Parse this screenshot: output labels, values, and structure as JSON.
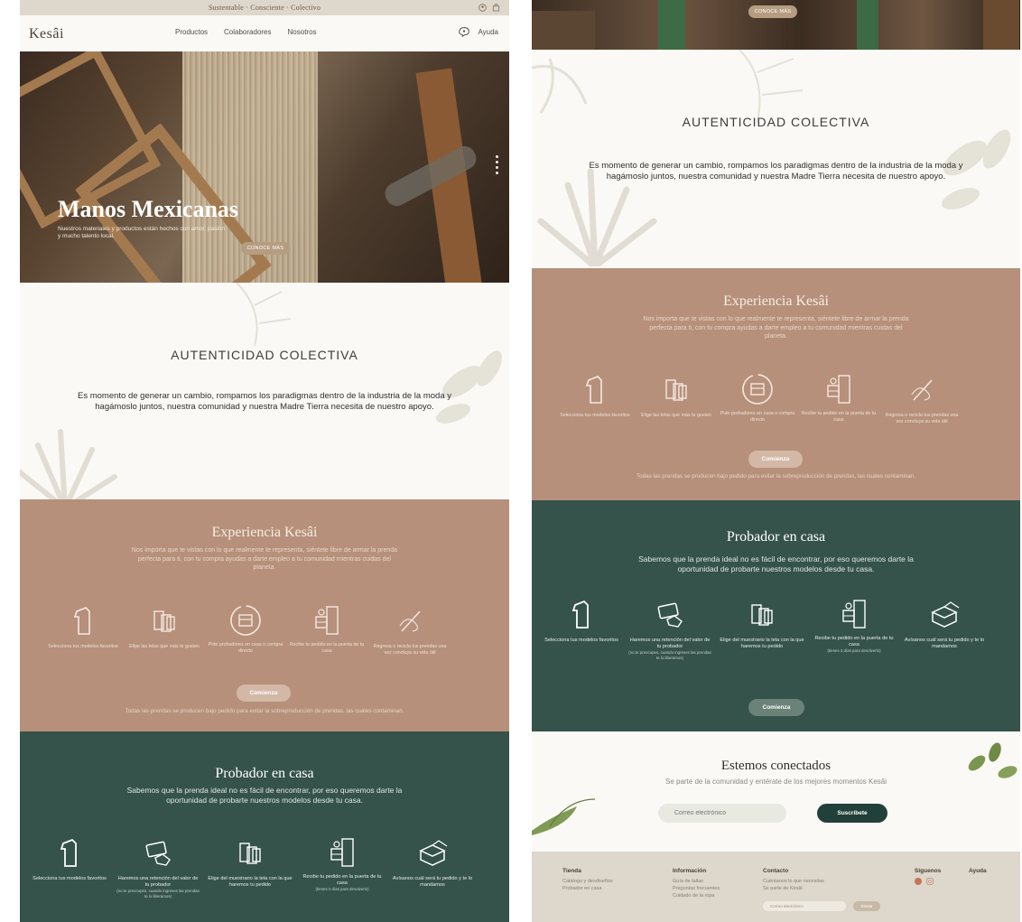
{
  "topbar": {
    "tagline": "Sustentable · Consciente · Colectivo"
  },
  "header": {
    "logo": "Kesâi",
    "nav": [
      "Productos",
      "Colaboradores",
      "Nosotros"
    ],
    "help_label": "Ayuda"
  },
  "hero": {
    "title": "Manos Mexicanas",
    "subtitle": "Nuestros materiales y productos están hechos con amor, pasión y mucho talento local.",
    "cta_label": "CONOCE MÁS"
  },
  "authenticity": {
    "title": "AUTENTICIDAD  COLECTIVA",
    "text": "Es momento de generar un cambio, rompamos los paradigmas dentro de la industria de la moda y hagámoslo juntos, nuestra comunidad y nuestra Madre Tierra necesita de nuestro apoyo."
  },
  "experience": {
    "title": "Experiencia Kesâi",
    "text": "Nos importa que te vistas con lo que realmente te representa, siéntete libre de armar la prenda perfecta para ti, con tu compra ayudas a darte empleo a tu comunidad mientras cuidas del planeta.",
    "steps": [
      "Selecciona tus modelos favoritos",
      "Elige las telas que más te gusten",
      "Pide probadores en casa o compra directo",
      "Recibe tu pedido en la puerta de tu casa",
      "Regresa o recicla tus prendas una vez concluya su vida útil"
    ],
    "cta_label": "Comienza",
    "note": "Todas las prendas se producen bajo pedido para evitar la sobreproducción de prendas, las cuales contaminan."
  },
  "fitting": {
    "title": "Probador en casa",
    "text": "Sabemos que la prenda ideal no es fácil de encontrar, por eso queremos darte la oportunidad de probarte nuestros modelos desde tu casa.",
    "steps": [
      {
        "label": "Selecciona tus modelos favoritos",
        "sub": ""
      },
      {
        "label": "Haremos una retención del valor de tu probador",
        "sub": "(no te preocupes, cuando ingreses las prendas te lo liberamos)"
      },
      {
        "label": "Elige del muestrario la tela con la que haremos tu pedido",
        "sub": ""
      },
      {
        "label": "Recibe tu pedido en la puerta de tu casa",
        "sub": "(tienes 3 días para devolverlo)"
      },
      {
        "label": "Avísanos cuál será tu pedido y te lo mandamos",
        "sub": ""
      }
    ],
    "cta_label": "Comienza"
  },
  "connect": {
    "title": "Estemos conectados",
    "text": "Se parte de la comunidad y entérate de los mejores momentos Kesâi",
    "email_placeholder": "Correo electrónico",
    "subscribe_label": "Suscríbete"
  },
  "footer": {
    "columns": [
      {
        "heading": "Tienda",
        "items": [
          "Catálogo y desdiseños",
          "Probador en casa"
        ]
      },
      {
        "heading": "Información",
        "items": [
          "Guía de tallas",
          "Preguntas frecuentes",
          "Cuidado de la ropa"
        ]
      },
      {
        "heading": "Contacto",
        "items": [
          "Cuéntanos lo que necesitas",
          "Se parte de Kesâi"
        ]
      },
      {
        "heading": "Síguenos",
        "items": []
      },
      {
        "heading": "Ayuda",
        "items": []
      }
    ],
    "email_placeholder": "Correo electrónico",
    "send_label": "Enviar"
  },
  "colors": {
    "cream": "#fbf9f5",
    "terracotta": "#b6907a",
    "forest": "#35524b",
    "sand": "#ddd7cc",
    "button_light": "#d3b8a6",
    "button_dark": "#22403a"
  }
}
